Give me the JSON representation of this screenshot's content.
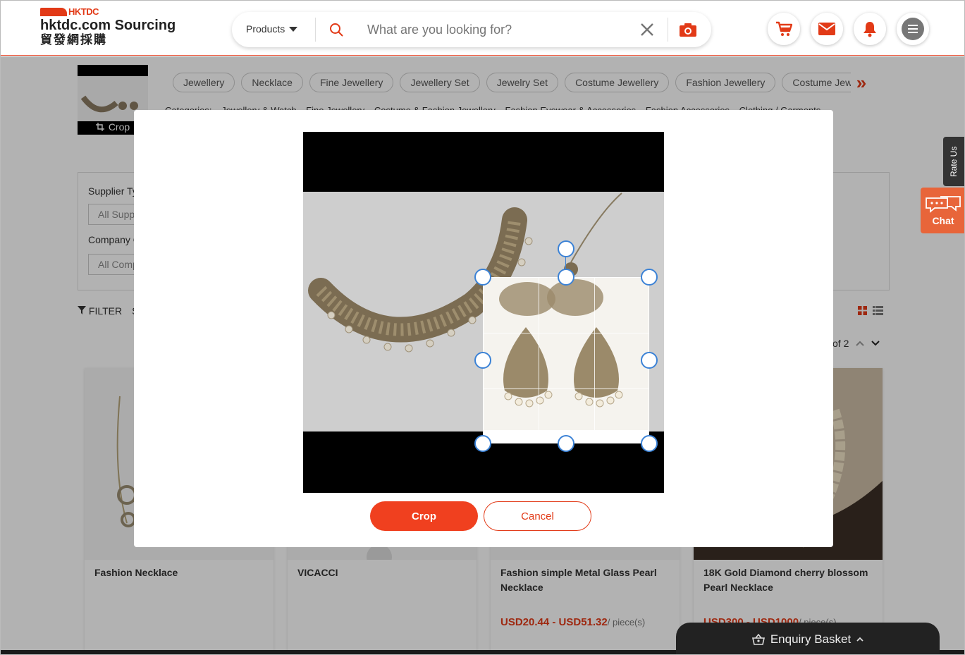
{
  "header": {
    "brand": "HKTDC",
    "site_name": "hktdc.com Sourcing",
    "site_name_cn": "貿發網採購",
    "products_label": "Products",
    "search_placeholder": "What are you looking for?"
  },
  "thumbnail": {
    "crop_label": "Crop"
  },
  "tags": [
    "Jewellery",
    "Necklace",
    "Fine Jewellery",
    "Jewellery Set",
    "Jewelry Set",
    "Costume Jewellery",
    "Fashion Jewellery",
    "Costume Jewel"
  ],
  "categories": {
    "label": "Categories:",
    "items": [
      "Jewellery & Watch",
      "Fine Jewellery",
      "Costume & Fashion Jewellery",
      "Fashion Eyewear & Accessories",
      "Fashion Accessories",
      "Clothing / Garments"
    ]
  },
  "filters": {
    "supplier_type_label": "Supplier Ty",
    "supplier_type_value": "All Supp",
    "company_label": "Company C",
    "company_value": "All Comp",
    "filter_label": "FILTER",
    "sort_label": "S"
  },
  "pager": {
    "text": "of 2"
  },
  "products": [
    {
      "title": "Fashion Necklace",
      "price": "",
      "unit": ""
    },
    {
      "title": "VICACCI",
      "price": "",
      "unit": ""
    },
    {
      "title": "Fashion simple Metal Glass Pearl Necklace",
      "price": "USD20.44 - USD51.32",
      "unit": "/ piece(s)"
    },
    {
      "title": "18K Gold Diamond cherry blossom Pearl Necklace",
      "price": "USD300 - USD1000",
      "unit": "/ piece(s)"
    }
  ],
  "side": {
    "rate_us": "Rate Us",
    "chat": "Chat"
  },
  "modal": {
    "crop_button": "Crop",
    "cancel_button": "Cancel"
  },
  "enquiry": {
    "label": "Enquiry Basket"
  },
  "colors": {
    "brand": "#e23a17",
    "crop_button": "#f0401f",
    "handle_border": "#3b82d6"
  }
}
